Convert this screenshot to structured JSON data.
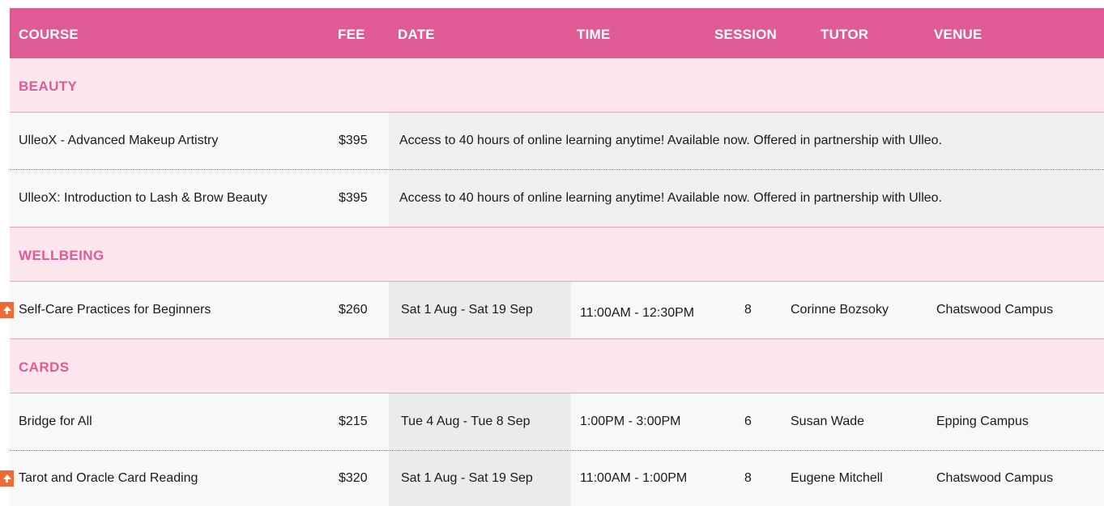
{
  "header": {
    "course": "COURSE",
    "fee": "FEE",
    "date": "DATE",
    "time": "TIME",
    "session": "SESSION",
    "tutor": "TUTOR",
    "venue": "VENUE"
  },
  "categories": {
    "beauty": "BEAUTY",
    "wellbeing": "WELLBEING",
    "cards": "CARDS"
  },
  "beauty_rows": [
    {
      "course": "UlleoX - Advanced Makeup Artistry",
      "fee": "$395",
      "note": "Access to 40 hours of online learning anytime! Available now. Offered in partnership with Ulleo."
    },
    {
      "course": "UlleoX: Introduction to Lash & Brow Beauty",
      "fee": "$395",
      "note": "Access to 40 hours of online learning anytime! Available now.  Offered in partnership with Ulleo."
    }
  ],
  "wellbeing_rows": [
    {
      "course": "Self-Care Practices for Beginners",
      "fee": "$260",
      "date": "Sat 1 Aug - Sat 19 Sep",
      "time": "11:00AM - 12:30PM",
      "session": "8",
      "tutor": "Corinne Bozsoky",
      "venue": "Chatswood Campus",
      "flag_icon": "arrow-up-icon"
    }
  ],
  "cards_rows": [
    {
      "course": "Bridge for All",
      "fee": "$215",
      "date": "Tue 4 Aug - Tue 8 Sep",
      "time": "1:00PM - 3:00PM",
      "session": "6",
      "tutor": "Susan Wade",
      "venue": "Epping Campus"
    },
    {
      "course": "Tarot and Oracle Card Reading",
      "fee": "$320",
      "date": "Sat 1 Aug - Sat 19 Sep",
      "time": "11:00AM - 1:00PM",
      "session": "8",
      "tutor": "Eugene Mitchell",
      "venue": "Chatswood Campus",
      "flag_icon": "arrow-up-icon"
    }
  ],
  "colors": {
    "header_bg": "#e05a96",
    "category_bg": "#fce6ee",
    "category_text": "#e05a96",
    "flag": "#ee6b35"
  }
}
